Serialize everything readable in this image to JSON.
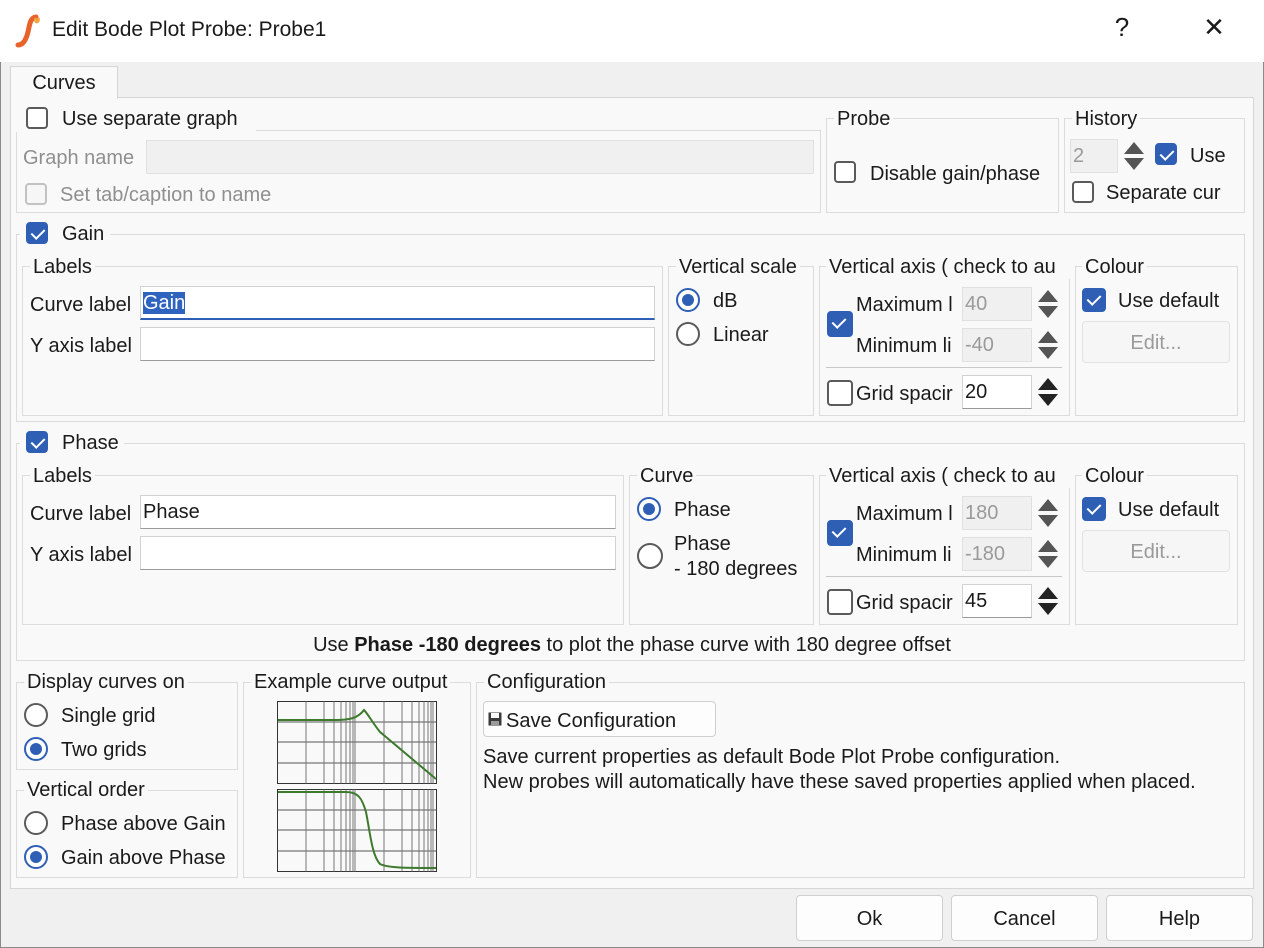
{
  "title": "Edit Bode Plot Probe: Probe1",
  "title_buttons": {
    "help": "?",
    "close": "✕"
  },
  "tab": "Curves",
  "graph": {
    "use_separate_graph": "Use separate graph",
    "graph_name_label": "Graph name",
    "graph_name_value": "",
    "set_tab_caption": "Set tab/caption to name"
  },
  "probe": {
    "group": "Probe",
    "disable_gain_phase": "Disable gain/phase"
  },
  "history": {
    "group": "History",
    "value": "2",
    "use": "Use",
    "separate_curves": "Separate cur"
  },
  "gain": {
    "title": "Gain",
    "labels_group": "Labels",
    "curve_label": "Curve label",
    "curve_value": "Gain",
    "y_axis_label": "Y axis label",
    "y_axis_value": "",
    "vscale_group": "Vertical scale",
    "opt_db": "dB",
    "opt_linear": "Linear",
    "axis_group": "Vertical axis ( check to au",
    "maximum": "Maximum l",
    "maximum_value": "40",
    "minimum": "Minimum li",
    "minimum_value": "-40",
    "grid_spacing": "Grid spacir",
    "grid_value": "20",
    "colour_group": "Colour",
    "use_default": "Use default",
    "edit": "Edit..."
  },
  "phase": {
    "title": "Phase",
    "labels_group": "Labels",
    "curve_label": "Curve label",
    "curve_value": "Phase",
    "y_axis_label": "Y axis label",
    "y_axis_value": "",
    "curve_group": "Curve",
    "opt_phase": "Phase",
    "opt_phase180_line1": "Phase",
    "opt_phase180_line2": "- 180 degrees",
    "axis_group": "Vertical axis ( check to au",
    "maximum": "Maximum l",
    "maximum_value": "180",
    "minimum": "Minimum li",
    "minimum_value": "-180",
    "grid_spacing": "Grid spacir",
    "grid_value": "45",
    "colour_group": "Colour",
    "use_default": "Use default",
    "edit": "Edit..."
  },
  "hint": {
    "pre": "Use ",
    "bold": "Phase -180 degrees",
    "post": " to plot the phase curve with 180 degree offset"
  },
  "display": {
    "group": "Display curves on",
    "single": "Single grid",
    "two": "Two grids"
  },
  "vorder": {
    "group": "Vertical order",
    "phase_above": "Phase above Gain",
    "gain_above": "Gain above Phase"
  },
  "example": {
    "group": "Example curve output"
  },
  "config": {
    "group": "Configuration",
    "save_button": "Save Configuration",
    "desc_line1": "Save current properties as default Bode Plot Probe configuration.",
    "desc_line2": "New probes will automatically have these saved properties applied when placed."
  },
  "footer": {
    "ok": "Ok",
    "cancel": "Cancel",
    "help": "Help"
  },
  "colors": {
    "accent": "#2f5fb5",
    "curve": "#3d7a2e",
    "app_icon": "#e8622a"
  }
}
